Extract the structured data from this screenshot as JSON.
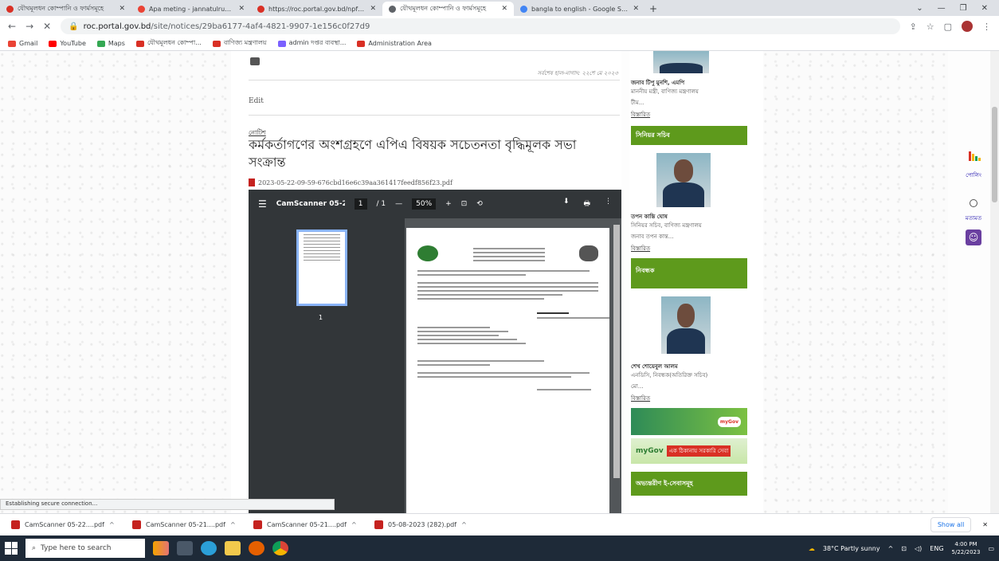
{
  "browser": {
    "tabs": [
      {
        "title": "যৌথমূলধন কোম্পানি ও ফার্মসমূহে",
        "favicon_color": "#d93025",
        "active": false
      },
      {
        "title": "Apa meting - jannatulruma18@g",
        "favicon_color": "#ea4335",
        "active": false
      },
      {
        "title": "https://roc.portal.gov.bd/npfadn",
        "favicon_color": "#d93025",
        "active": false
      },
      {
        "title": "যৌথমূলধন কোম্পানি ও ফার্মসমূহে",
        "favicon_color": "#5f6368",
        "active": true
      },
      {
        "title": "bangla to english - Google Sear",
        "favicon_color": "#4285f4",
        "active": false
      }
    ],
    "new_tab": "+",
    "window_controls": {
      "down": "⌄",
      "minimize": "—",
      "restore": "❐",
      "close": "✕"
    },
    "url_host": "roc.portal.gov.bd",
    "url_path": "/site/notices/29ba6177-4af4-4821-9907-1e156c0f27d9",
    "bookmarks": [
      {
        "label": "Gmail",
        "color": "#ea4335"
      },
      {
        "label": "YouTube",
        "color": "#ff0000"
      },
      {
        "label": "Maps",
        "color": "#34a853"
      },
      {
        "label": "যৌথমূলধন কোম্পা...",
        "color": "#d93025"
      },
      {
        "label": "বাণিজ্য মন্ত্রণালয়",
        "color": "#d93025"
      },
      {
        "label": "admin দপ্তর ব্যবস্থা...",
        "color": "#7b61ff"
      },
      {
        "label": "Administration Area",
        "color": "#d93025"
      }
    ]
  },
  "page": {
    "date_line": "সর্বশেষ হাল-নাগাদ: ২২শে মে ২০২৩",
    "edit_label": "Edit",
    "category": "নোটিশ",
    "title": "কর্মকর্তাগণের অংশগ্রহণে এপিএ বিষয়ক সচেতনতা বৃদ্ধিমূলক সভা সংক্রান্ত",
    "pdf_link": "2023-05-22-09-59-676cbd16e6c39aa361417feedf856f23.pdf",
    "viewer": {
      "menu": "☰",
      "filename": "CamScanner 05-2...",
      "page_current": "1",
      "page_total": "/ 1",
      "zoom_minus": "—",
      "zoom": "50%",
      "zoom_plus": "+",
      "fit": "⊡",
      "rotate": "⟲",
      "download": "⬇",
      "print": "🖶",
      "more": "⋮",
      "thumb_number": "1"
    }
  },
  "sidebar": {
    "person1_name": "জনাব টিপু মুনশি, এমপি",
    "person1_role": "মাননীয় মন্ত্রী, বাণিজ্য মন্ত্রণালয়",
    "person1_extra": "টীম...",
    "details1": "বিস্তারিত",
    "secretary_heading": "সিনিয়র সচিব",
    "person2_name": "তপন কান্তি ঘোষ",
    "person2_role": "সিনিয়র সচিব, বাণিজ্য মন্ত্রণালয়",
    "person2_extra": "জনাব তপন কান্ত...",
    "details2": "বিস্তারিত",
    "registrar_heading": "নিবন্ধক",
    "person3_name": "শেখ শোয়েবুল আলম",
    "person3_role": "এনডিসি, নিবন্ধক(অতিরিক্ত সচিব)",
    "person3_extra": "মো...",
    "details3": "বিস্তারিত",
    "mygov": "myGov",
    "mygov_tagline": "এক ঠিকানায় সরকারি সেবা",
    "eservices_heading": "অভ্যন্তরীণ ই-সেবাসমূহ",
    "accent": "#5e9a1c"
  },
  "right_widgets": {
    "poll_label": "পোলিং",
    "feedback_label": "মতামত"
  },
  "status": "Establishing secure connection...",
  "downloads": {
    "items": [
      "CamScanner 05-22....pdf",
      "CamScanner 05-21....pdf",
      "CamScanner 05-21....pdf",
      "05-08-2023 (282).pdf"
    ],
    "chevron": "^",
    "show_all": "Show all",
    "close": "✕"
  },
  "taskbar": {
    "search_placeholder": "Type here to search",
    "weather": "38°C  Partly sunny",
    "lang": "ENG",
    "time": "4:00 PM",
    "date": "5/22/2023"
  }
}
